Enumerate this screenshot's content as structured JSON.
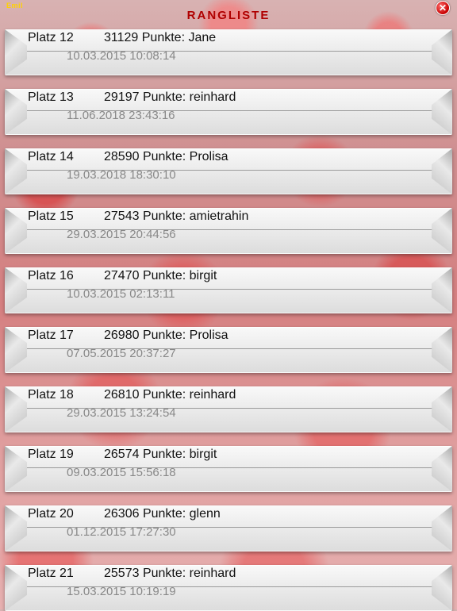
{
  "header": {
    "corner_label": "Emil",
    "title": "RANGLISTE",
    "close_glyph": "✕"
  },
  "colors": {
    "title": "#b00000",
    "close_button": "#c70000",
    "corner_label": "#ffd200"
  },
  "entries": [
    {
      "rank": "Platz 12",
      "score": "31129 Punkte: Jane",
      "date": "10.03.2015 10:08:14"
    },
    {
      "rank": "Platz 13",
      "score": "29197 Punkte: reinhard",
      "date": "11.06.2018 23:43:16"
    },
    {
      "rank": "Platz 14",
      "score": "28590 Punkte: Prolisa",
      "date": "19.03.2018 18:30:10"
    },
    {
      "rank": "Platz 15",
      "score": "27543 Punkte: amietrahin",
      "date": "29.03.2015 20:44:56"
    },
    {
      "rank": "Platz 16",
      "score": "27470 Punkte: birgit",
      "date": "10.03.2015 02:13:11"
    },
    {
      "rank": "Platz 17",
      "score": "26980 Punkte: Prolisa",
      "date": "07.05.2015 20:37:27"
    },
    {
      "rank": "Platz 18",
      "score": "26810 Punkte: reinhard",
      "date": "29.03.2015 13:24:54"
    },
    {
      "rank": "Platz 19",
      "score": "26574 Punkte: birgit",
      "date": "09.03.2015 15:56:18"
    },
    {
      "rank": "Platz 20",
      "score": "26306 Punkte: glenn",
      "date": "01.12.2015 17:27:30"
    },
    {
      "rank": "Platz 21",
      "score": "25573 Punkte: reinhard",
      "date": "15.03.2015 10:19:19"
    }
  ]
}
